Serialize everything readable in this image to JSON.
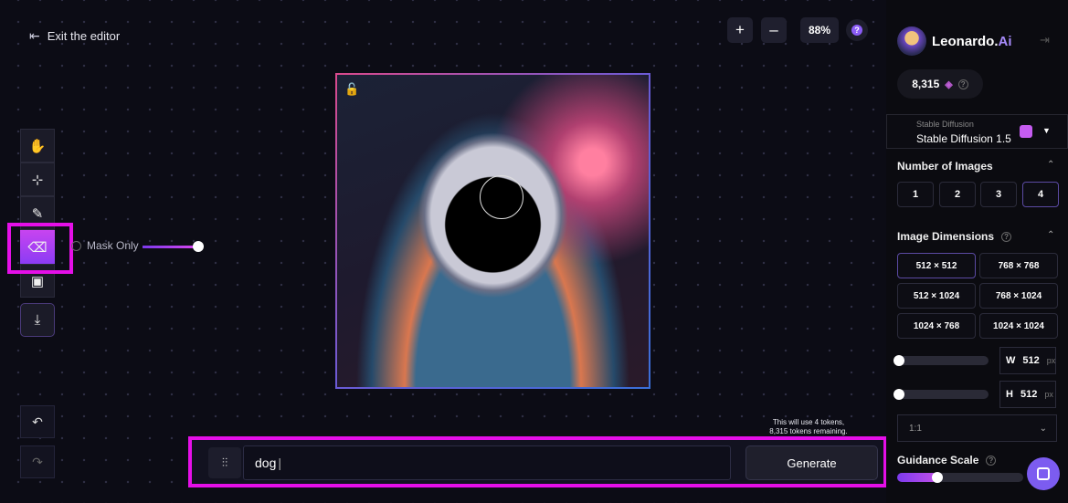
{
  "header": {
    "exit_label": "Exit the editor",
    "exit_icon": "arrow-left-bar-icon"
  },
  "zoom": {
    "plus": "+",
    "minus": "–",
    "value": "88%"
  },
  "tools": [
    {
      "name": "hand-icon",
      "glyph": "✋"
    },
    {
      "name": "select-icon",
      "glyph": "⊹"
    },
    {
      "name": "brush-icon",
      "glyph": "✎"
    },
    {
      "name": "eraser-icon",
      "glyph": "⌫"
    },
    {
      "name": "image-icon",
      "glyph": "▣"
    },
    {
      "name": "download-icon",
      "glyph": "⤓"
    }
  ],
  "mask": {
    "label": "Mask Only",
    "level": 1.0
  },
  "history": {
    "undo": "↶",
    "redo": "↷"
  },
  "prompt": {
    "value": "dog",
    "generate_label": "Generate",
    "token_note_line1": "This will use 4 tokens,",
    "token_note_line2": "8,315 tokens remaining."
  },
  "sidebar": {
    "brand": "Leonardo.",
    "brand_ai": "Ai",
    "tokens": "8,315",
    "model_label": "Stable Diffusion",
    "model_value": "Stable Diffusion 1.5",
    "num_images_title": "Number of Images",
    "num_images": [
      "1",
      "2",
      "3",
      "4"
    ],
    "num_selected": "4",
    "dims_title": "Image Dimensions",
    "dims": [
      "512 × 512",
      "768 × 768",
      "512 × 1024",
      "768 × 1024",
      "1024 × 768",
      "1024 × 1024"
    ],
    "width_label": "W",
    "width_value": "512",
    "px": "px",
    "height_label": "H",
    "height_value": "512",
    "ratio": "1:1",
    "guidance_title": "Guidance Scale"
  },
  "colors": {
    "accent": "#e50fe8",
    "purple": "#8b5cf6"
  }
}
